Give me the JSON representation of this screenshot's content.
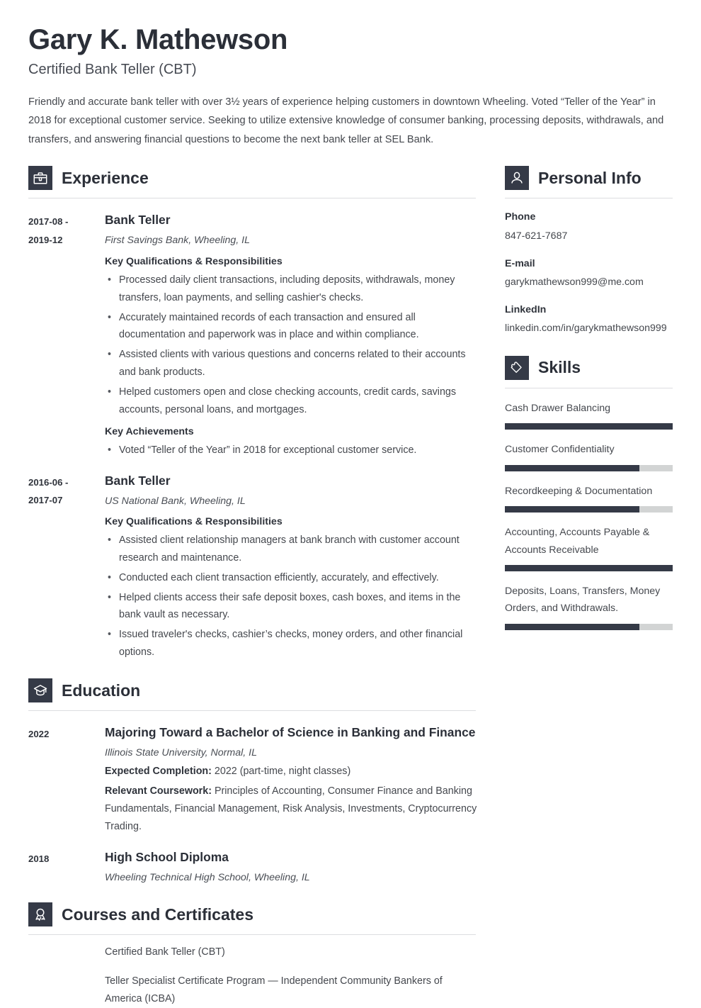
{
  "theme": {
    "dark": "#353a47",
    "text": "#45484e",
    "heading": "#2b2f38",
    "rule": "#dcdde0",
    "bar_track": "#d2d4d4"
  },
  "header": {
    "name": "Gary K. Mathewson",
    "job_title": "Certified Bank Teller (CBT)",
    "summary": "Friendly and accurate bank teller with over 3½ years of experience helping customers in downtown Wheeling. Voted “Teller of the Year” in 2018 for exceptional customer service. Seeking to utilize extensive knowledge of consumer banking, processing deposits, withdrawals, and transfers, and answering financial questions to become the next bank teller at SEL Bank."
  },
  "experience": {
    "icon": "briefcase-icon",
    "title": "Experience",
    "entries": [
      {
        "date": "2017-08 - 2019-12",
        "date_line1": "2017-08 -",
        "date_line2": "2019-12",
        "role": "Bank Teller",
        "org": "First Savings Bank, Wheeling, IL",
        "sub1": "Key Qualifications & Responsibilities",
        "bullets1": [
          "Processed daily client transactions, including deposits, withdrawals, money transfers, loan payments, and selling cashier's checks.",
          "Accurately maintained records of each transaction and ensured all documentation and paperwork was in place and within compliance.",
          "Assisted clients with various questions and concerns related to their accounts and bank products.",
          "Helped customers open and close checking accounts, credit cards, savings accounts, personal loans, and mortgages."
        ],
        "sub2": "Key Achievements",
        "bullets2": [
          "Voted “Teller of the Year” in 2018 for exceptional customer service."
        ]
      },
      {
        "date": "2016-06 - 2017-07",
        "date_line1": "2016-06 -",
        "date_line2": "2017-07",
        "role": "Bank Teller",
        "org": "US National Bank, Wheeling, IL",
        "sub1": "Key Qualifications & Responsibilities",
        "bullets1": [
          "Assisted client relationship managers at bank branch with customer account research and maintenance.",
          "Conducted each client transaction efficiently, accurately, and effectively.",
          "Helped clients access their safe deposit boxes, cash boxes, and items in the bank vault as necessary.",
          "Issued traveler's checks, cashier’s checks, money orders, and other financial options."
        ],
        "sub2": "",
        "bullets2": []
      }
    ]
  },
  "education": {
    "icon": "graduation-cap-icon",
    "title": "Education",
    "entries": [
      {
        "date": "2022",
        "degree": "Majoring Toward a Bachelor of Science in Banking and Finance",
        "school": "Illinois State University, Normal, IL",
        "detail_label_1": "Expected Completion:",
        "detail_value_1": "2022 (part-time, night classes)",
        "detail_label_2": "Relevant Coursework:",
        "detail_value_2": "Principles of Accounting, Consumer Finance and Banking Fundamentals, Financial Management, Risk Analysis, Investments, Cryptocurrency Trading."
      },
      {
        "date": "2018",
        "degree": "High School Diploma",
        "school": "Wheeling Technical High School, Wheeling, IL",
        "detail_label_1": "",
        "detail_value_1": "",
        "detail_label_2": "",
        "detail_value_2": ""
      }
    ]
  },
  "courses": {
    "icon": "award-ribbon-icon",
    "title": "Courses and Certificates",
    "items": [
      "Certified Bank Teller (CBT)",
      "Teller Specialist Certificate Program — Independent Community Bankers of America (ICBA)"
    ]
  },
  "personal_info": {
    "icon": "person-icon",
    "title": "Personal Info",
    "fields": [
      {
        "label": "Phone",
        "value": "847-621-7687"
      },
      {
        "label": "E-mail",
        "value": "garykmathewson999@me.com"
      },
      {
        "label": "LinkedIn",
        "value": "linkedin.com/in/garykmathewson999"
      }
    ]
  },
  "skills": {
    "icon": "puzzle-piece-icon",
    "title": "Skills",
    "items": [
      {
        "name": "Cash Drawer Balancing",
        "level": 100
      },
      {
        "name": "Customer Confidentiality",
        "level": 80
      },
      {
        "name": "Recordkeeping & Documentation",
        "level": 80
      },
      {
        "name": "Accounting, Accounts Payable & Accounts Receivable",
        "level": 100
      },
      {
        "name": "Deposits, Loans, Transfers, Money Orders, and Withdrawals.",
        "level": 80
      }
    ]
  }
}
